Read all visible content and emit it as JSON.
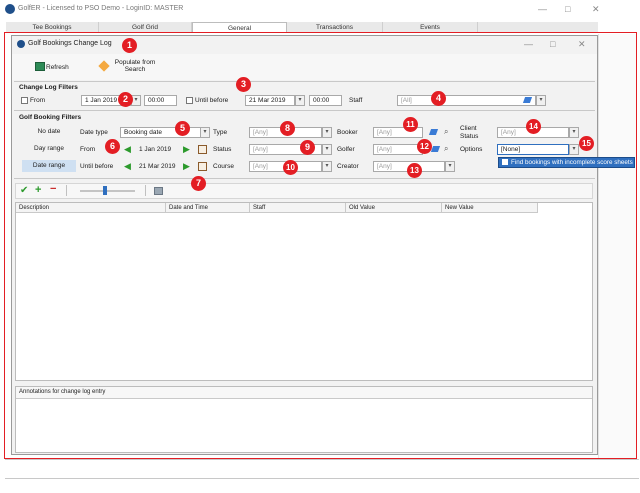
{
  "app": {
    "title": "GolfER - Licensed to PSO Demo - LoginID: MASTER",
    "tabs": [
      "Tee Bookings",
      "Golf Grid",
      "General",
      "Transactions",
      "Events"
    ],
    "active_tab": "General"
  },
  "dialog": {
    "title": "Golf Bookings Change Log",
    "toolbar": {
      "refresh_label": "Refresh",
      "populate_label": "Populate from Search"
    }
  },
  "change_log_filters": {
    "heading": "Change Log Filters",
    "from_label": "From",
    "from_date": "1 Jan 2019",
    "from_time": "00:00",
    "until_label": "Until before",
    "until_date": "21 Mar 2019",
    "until_time": "00:00",
    "staff_label": "Staff",
    "staff_value": "[All]"
  },
  "golf_booking_filters": {
    "heading": "Golf Booking Filters",
    "row_labels": [
      "No date",
      "Day range",
      "Date range"
    ],
    "date_type_label": "Date type",
    "date_type_value": "Booking date",
    "from_label": "From",
    "from_date": "1 Jan 2019",
    "until_label": "Until before",
    "until_date": "21 Mar 2019",
    "type_label": "Type",
    "type_value": "[Any]",
    "status_label": "Status",
    "status_value": "[Any]",
    "course_label": "Course",
    "course_value": "[Any]",
    "booker_label": "Booker",
    "booker_value": "[Any]",
    "golfer_label": "Golfer",
    "golfer_value": "[Any]",
    "creator_label": "Creator",
    "creator_value": "[Any]",
    "client_status_label": "Client Status",
    "client_status_value": "[Any]",
    "options_label": "Options",
    "options_value": "[None]",
    "options_popup_item": "Find bookings with incomplete score sheets"
  },
  "grid": {
    "columns": [
      "Description",
      "Date and Time",
      "Staff",
      "Old Value",
      "New Value"
    ]
  },
  "annotations": {
    "title": "Annotations for change log entry"
  },
  "badges": [
    "1",
    "2",
    "3",
    "4",
    "5",
    "6",
    "7",
    "8",
    "9",
    "10",
    "11",
    "12",
    "13",
    "14",
    "15"
  ],
  "colors": {
    "badge": "#e31e24",
    "frame": "#e31e24",
    "selection": "#2f6fbf",
    "accent_green": "#2c9a2c"
  }
}
